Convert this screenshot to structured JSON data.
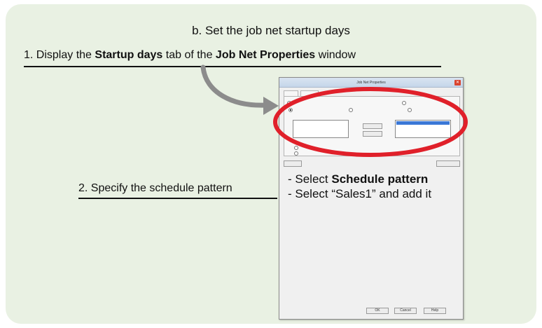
{
  "heading": "b. Set the job net startup days",
  "step1": {
    "prefix": "1. Display the ",
    "bold1": "Startup days",
    "middle": " tab of the ",
    "bold2": "Job Net Properties",
    "suffix": " window"
  },
  "step2": "2. Specify the schedule pattern",
  "dialog": {
    "title": "Job Net Properties",
    "instructions": {
      "line1_prefix": "- Select ",
      "line1_bold": "Schedule pattern",
      "line2": "- Select “Sales1” and add it"
    },
    "buttons": {
      "ok": "OK",
      "cancel": "Cancel",
      "help": "Help"
    }
  },
  "colors": {
    "panel_bg": "#e9f1e3",
    "highlight_oval": "#e0202a",
    "arrow": "#8c8c8c"
  }
}
